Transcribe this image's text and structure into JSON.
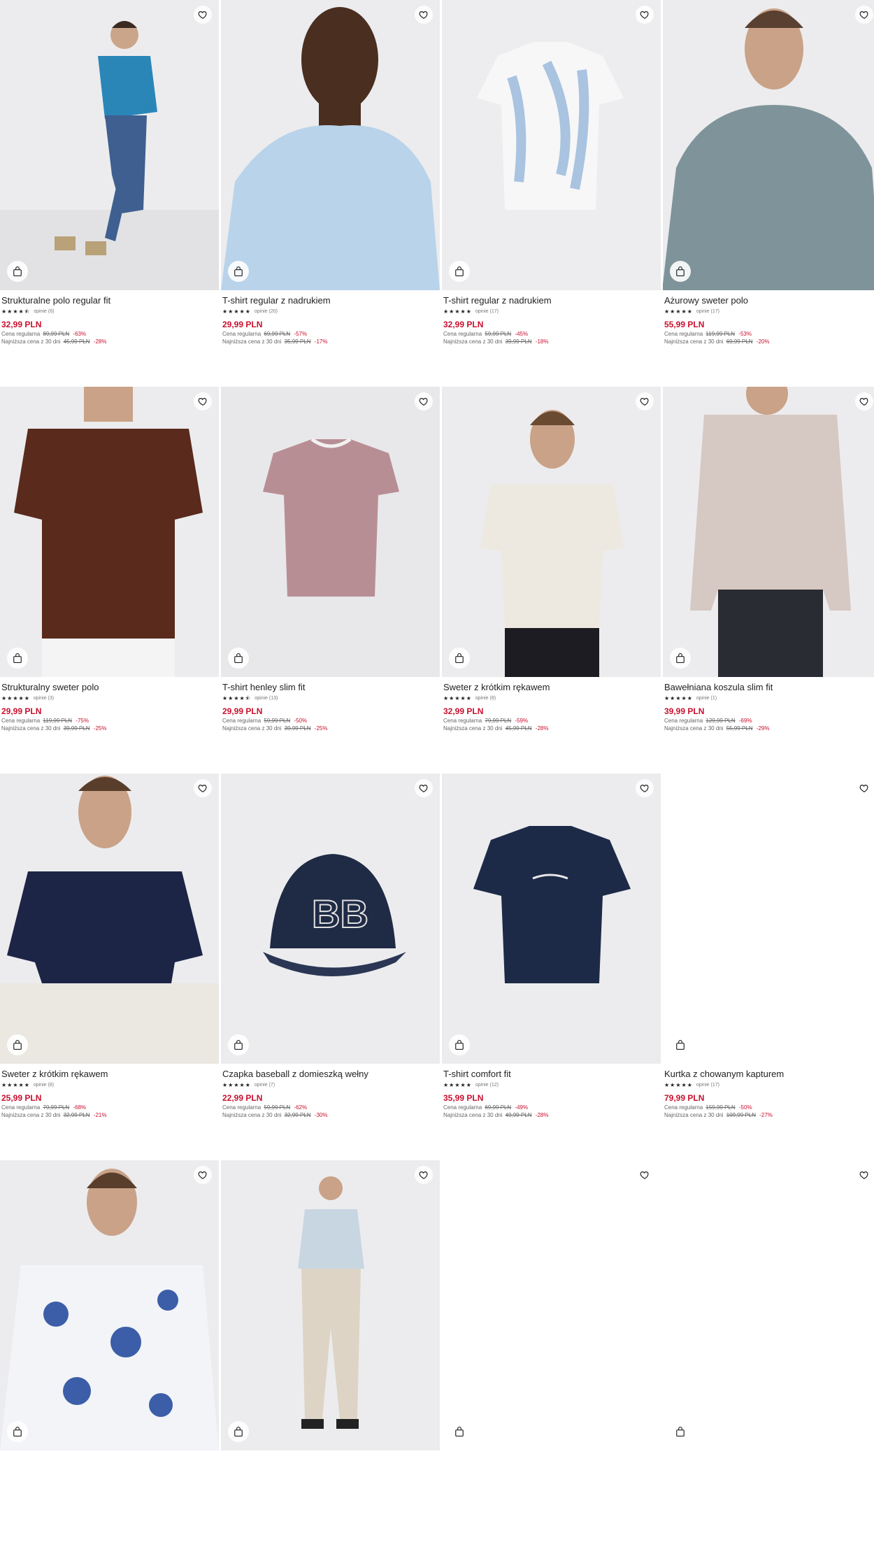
{
  "labels": {
    "regular": "Cena regularna",
    "lowest": "Najniższa cena z 30 dni"
  },
  "colors": {
    "accent": "#c8102e",
    "text": "#222222"
  },
  "products": [
    {
      "name": "Strukturalne polo regular fit",
      "stars": "★★★★⯪",
      "reviews": "opinie (6)",
      "price": "32,99 PLN",
      "regular": "89,99 PLN",
      "regular_disc": "-63%",
      "lowest": "45,99 PLN",
      "lowest_disc": "-28%",
      "image": "man-in-blue-polo"
    },
    {
      "name": "T-shirt regular z nadrukiem",
      "stars": "★★★★★",
      "reviews": "opinie (20)",
      "price": "29,99 PLN",
      "regular": "69,99 PLN",
      "regular_disc": "-57%",
      "lowest": "35,99 PLN",
      "lowest_disc": "-17%",
      "image": "light-blue-tshirt-closeup"
    },
    {
      "name": "T-shirt regular z nadrukiem",
      "stars": "★★★★★",
      "reviews": "opinie (17)",
      "price": "32,99 PLN",
      "regular": "59,99 PLN",
      "regular_disc": "-45%",
      "lowest": "39,99 PLN",
      "lowest_disc": "-18%",
      "image": "white-blue-print-tshirt"
    },
    {
      "name": "Ażurowy sweter polo",
      "stars": "★★★★★",
      "reviews": "opinie (17)",
      "price": "55,99 PLN",
      "regular": "119,99 PLN",
      "regular_disc": "-53%",
      "lowest": "69,99 PLN",
      "lowest_disc": "-20%",
      "image": "grey-knit-polo"
    },
    {
      "name": "Strukturalny sweter polo",
      "stars": "★★★★★",
      "reviews": "opinie (3)",
      "price": "29,99 PLN",
      "regular": "119,99 PLN",
      "regular_disc": "-75%",
      "lowest": "39,99 PLN",
      "lowest_disc": "-25%",
      "image": "brown-knit-polo"
    },
    {
      "name": "T-shirt henley slim fit",
      "stars": "★★★★⯪",
      "reviews": "opinie (13)",
      "price": "29,99 PLN",
      "regular": "59,99 PLN",
      "regular_disc": "-50%",
      "lowest": "39,99 PLN",
      "lowest_disc": "-25%",
      "image": "mauve-henley"
    },
    {
      "name": "Sweter z krótkim rękawem",
      "stars": "★★★★★",
      "reviews": "opinie (8)",
      "price": "32,99 PLN",
      "regular": "79,99 PLN",
      "regular_disc": "-59%",
      "lowest": "45,99 PLN",
      "lowest_disc": "-28%",
      "image": "cream-knit-tee"
    },
    {
      "name": "Bawełniana koszula slim fit",
      "stars": "★★★★★",
      "reviews": "opinie (1)",
      "price": "39,99 PLN",
      "regular": "129,99 PLN",
      "regular_disc": "-69%",
      "lowest": "55,99 PLN",
      "lowest_disc": "-29%",
      "image": "printed-shirt"
    },
    {
      "name": "Sweter z krótkim rękawem",
      "stars": "★★★★★",
      "reviews": "opinie (8)",
      "price": "25,99 PLN",
      "regular": "79,99 PLN",
      "regular_disc": "-68%",
      "lowest": "32,99 PLN",
      "lowest_disc": "-21%",
      "image": "navy-knit-tee"
    },
    {
      "name": "Czapka baseball z domieszką wełny",
      "stars": "★★★★★",
      "reviews": "opinie (7)",
      "price": "22,99 PLN",
      "regular": "59,99 PLN",
      "regular_disc": "-62%",
      "lowest": "32,99 PLN",
      "lowest_disc": "-30%",
      "image": "navy-cap"
    },
    {
      "name": "T-shirt comfort fit",
      "stars": "★★★★★",
      "reviews": "opinie (12)",
      "price": "35,99 PLN",
      "regular": "69,99 PLN",
      "regular_disc": "-49%",
      "lowest": "49,99 PLN",
      "lowest_disc": "-28%",
      "image": "navy-tshirt"
    },
    {
      "name": "Kurtka z chowanym kapturem",
      "stars": "★★★★★",
      "reviews": "opinie (17)",
      "price": "79,99 PLN",
      "regular": "159,99 PLN",
      "regular_disc": "-50%",
      "lowest": "109,99 PLN",
      "lowest_disc": "-27%",
      "image": "blank"
    },
    {
      "name": "",
      "image": "floral-shirt-man"
    },
    {
      "name": "",
      "image": "man-in-light-polo"
    },
    {
      "name": "",
      "image": "blank"
    },
    {
      "name": "",
      "image": "blank"
    }
  ]
}
